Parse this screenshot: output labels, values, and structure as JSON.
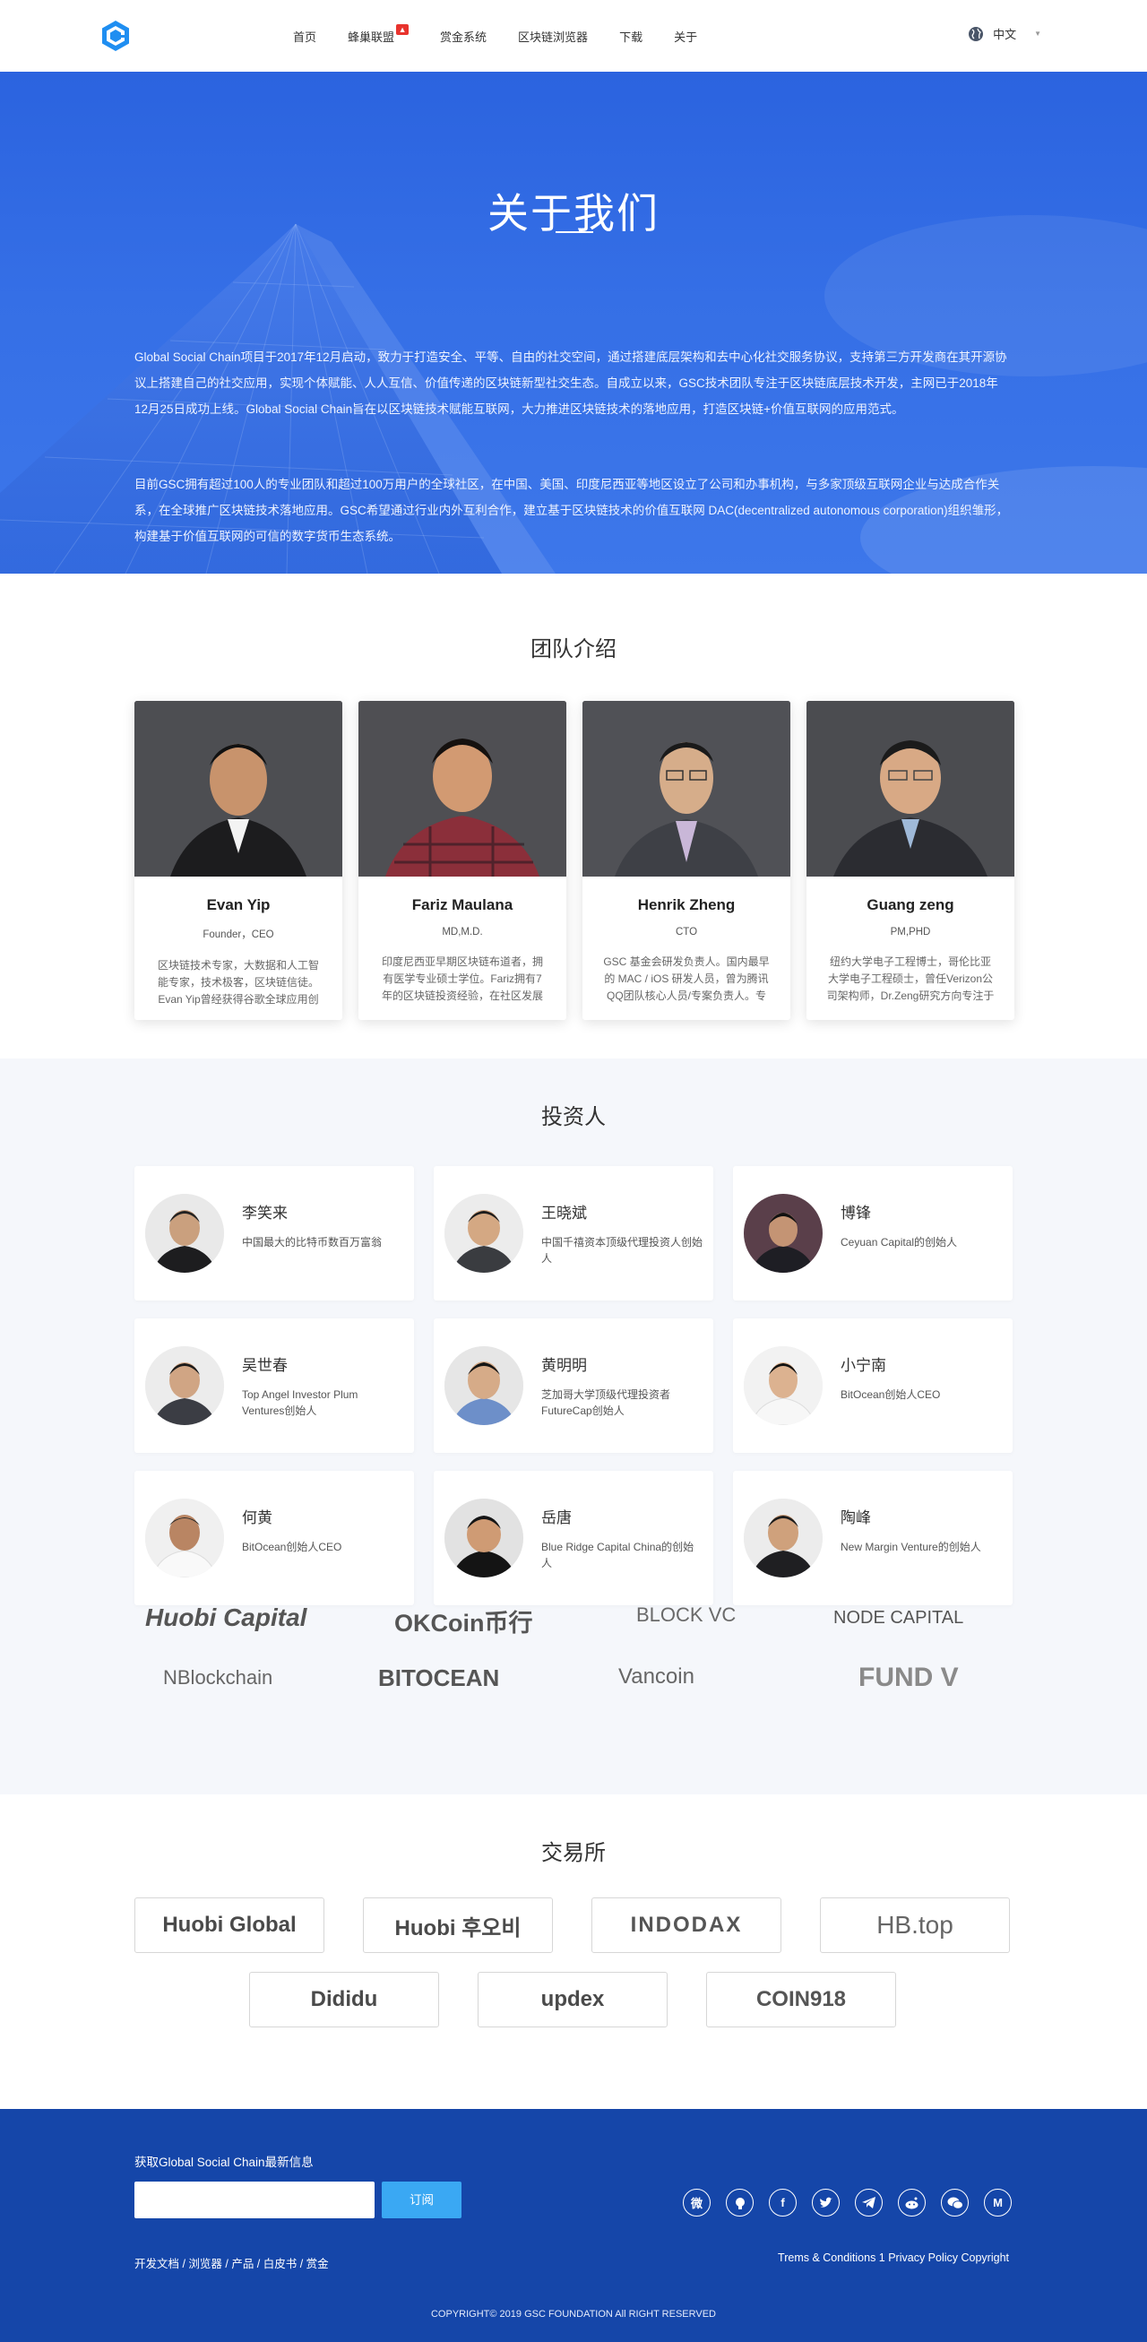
{
  "nav": {
    "items": [
      {
        "label": "首页"
      },
      {
        "label": "蜂巢联盟",
        "hot": true
      },
      {
        "label": "赏金系统"
      },
      {
        "label": "区块链浏览器"
      },
      {
        "label": "下载"
      },
      {
        "label": "关于"
      }
    ],
    "lang_label": "中文"
  },
  "hero": {
    "title": "关于我们",
    "p1": "Global Social Chain项目于2017年12月启动，致力于打造安全、平等、自由的社交空间，通过搭建底层架构和去中心化社交服务协议，支持第三方开发商在其开源协议上搭建自己的社交应用，实现个体赋能、人人互信、价值传递的区块链新型社交生态。自成立以来，GSC技术团队专注于区块链底层技术开发，主网已于2018年12月25日成功上线。Global Social Chain旨在以区块链技术赋能互联网，大力推进区块链技术的落地应用，打造区块链+价值互联网的应用范式。",
    "p2": "目前GSC拥有超过100人的专业团队和超过100万用户的全球社区，在中国、美国、印度尼西亚等地区设立了公司和办事机构，与多家顶级互联网企业与达成合作关系，在全球推广区块链技术落地应用。GSC希望通过行业内外互利合作，建立基于区块链技术的价值互联网 DAC(decentralized autonomous corporation)组织雏形，构建基于价值互联网的可信的数字货币生态系统。"
  },
  "team": {
    "title": "团队介绍",
    "members": [
      {
        "name": "Evan Yip",
        "role": "Founder，CEO",
        "desc": "区块链技术专家，大数据和人工智能专家，技术极客，区块链信徒。Evan Yip曾经获得谷歌全球应用创"
      },
      {
        "name": "Fariz Maulana",
        "role": "MD,M.D.",
        "desc": "印度尼西亚早期区块链布道者，拥有医学专业硕士学位。Fariz拥有7年的区块链投资经验，在社区发展"
      },
      {
        "name": "Henrik Zheng",
        "role": "CTO",
        "desc": "GSC 基金会研发负责人。国内最早的 MAC / iOS 研发人员，曾为腾讯QQ团队核心人员/专案负责人。专"
      },
      {
        "name": "Guang zeng",
        "role": "PM,PHD",
        "desc": "纽约大学电子工程博士，哥伦比亚大学电子工程硕士，曾任Verizon公司架构师，Dr.Zeng研究方向专注于"
      }
    ]
  },
  "investors": {
    "title": "投资人",
    "list": [
      {
        "name": "李笑来",
        "desc": "中国最大的比特币数百万富翁"
      },
      {
        "name": "王晓斌",
        "desc": "中国千禧资本顶级代理投资人创始人"
      },
      {
        "name": "博锋",
        "desc": "Ceyuan Capital的创始人"
      },
      {
        "name": "吴世春",
        "desc": "Top Angel Investor Plum Ventures创始人"
      },
      {
        "name": "黄明明",
        "desc": "芝加哥大学顶级代理投资者FutureCap创始人"
      },
      {
        "name": "小宁南",
        "desc": "BitOcean创始人CEO"
      },
      {
        "name": "何黄",
        "desc": "BitOcean创始人CEO"
      },
      {
        "name": "岳唐",
        "desc": "Blue Ridge Capital China的创始人"
      },
      {
        "name": "陶峰",
        "desc": "New Margin Venture的创始人"
      }
    ],
    "logos": [
      {
        "text": "Huobi Capital"
      },
      {
        "text": "OKCoin币行"
      },
      {
        "text": "BLOCK VC"
      },
      {
        "text": "NODE CAPITAL"
      },
      {
        "text": "NBlockchain"
      },
      {
        "text": "BITOCEAN"
      },
      {
        "text": "Vancoin"
      },
      {
        "text": "FUND V"
      }
    ]
  },
  "exchange": {
    "title": "交易所",
    "list": [
      {
        "text": "Huobi Global"
      },
      {
        "text": "Huobi 후오비"
      },
      {
        "text": "INDODAX"
      },
      {
        "text": "HB.top"
      },
      {
        "text": "Dididu"
      },
      {
        "text": "updex"
      },
      {
        "text": "COIN918"
      }
    ]
  },
  "footer": {
    "subscribe_title": "获取Global Social Chain最新信息",
    "subscribe_btn": "订阅",
    "socials": [
      "weibo-icon",
      "github-icon",
      "facebook-icon",
      "twitter-icon",
      "telegram-icon",
      "reddit-icon",
      "wechat-icon",
      "medium-icon"
    ],
    "links": "开发文档 / 浏览器 / 产品 / 白皮书 / 赏金",
    "legal": "Trems & Conditions 1 Privacy Policy Copyright",
    "copyright": "COPYRIGHT© 2019 GSC FOUNDATION All RIGHT RESERVED"
  },
  "colors": {
    "hero_blue": "#2f68e2",
    "footer_blue": "#1546a9",
    "subscribe_button": "#3aa8f3",
    "hot_badge": "#e8332d"
  }
}
